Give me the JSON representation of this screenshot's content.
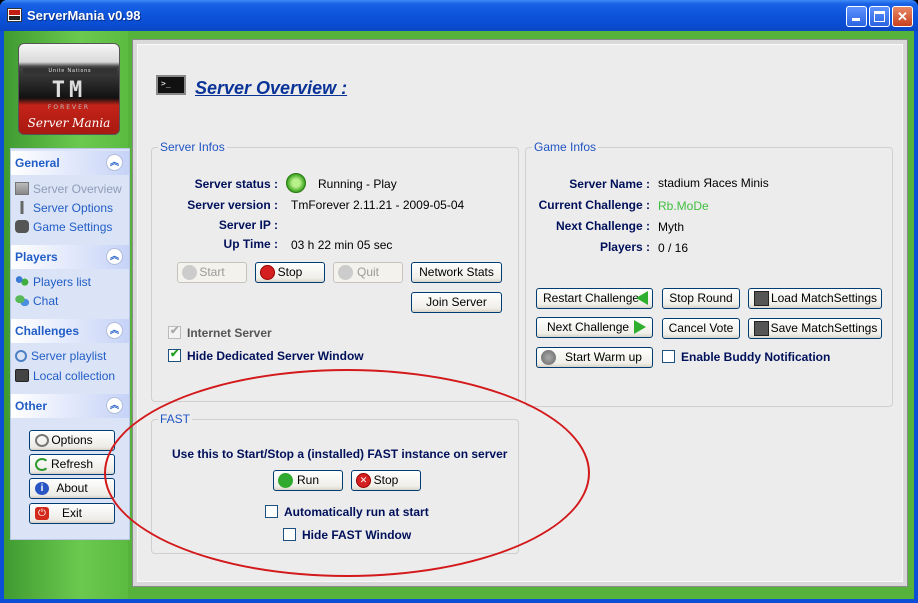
{
  "window": {
    "title": "ServerMania v0.98"
  },
  "logo": {
    "band_text": "Unite Nations",
    "tm_text": "TM",
    "sub_text": "FOREVER",
    "brand_text": "Server Mania"
  },
  "sidebar": {
    "general": {
      "title": "General",
      "items": [
        {
          "label": "Server Overview"
        },
        {
          "label": "Server Options"
        },
        {
          "label": "Game Settings"
        }
      ]
    },
    "players": {
      "title": "Players",
      "items": [
        {
          "label": "Players list"
        },
        {
          "label": "Chat"
        }
      ]
    },
    "challenges": {
      "title": "Challenges",
      "items": [
        {
          "label": "Server playlist"
        },
        {
          "label": "Local collection"
        }
      ]
    },
    "other": {
      "title": "Other",
      "buttons": [
        {
          "label": "Options"
        },
        {
          "label": "Refresh"
        },
        {
          "label": "About"
        },
        {
          "label": "Exit"
        }
      ]
    }
  },
  "page": {
    "title": "Server Overview :"
  },
  "server_infos": {
    "title": "Server Infos",
    "status_label": "Server status :",
    "status_value": "Running - Play",
    "version_label": "Server version :",
    "version_value": "TmForever 2.11.21 - 2009-05-04",
    "ip_label": "Server IP :",
    "ip_value": "",
    "uptime_label": "Up Time :",
    "uptime_value": "03 h 22 min 05 sec",
    "buttons": {
      "start": "Start",
      "stop": "Stop",
      "quit": "Quit",
      "network_stats": "Network Stats",
      "join_server": "Join Server"
    },
    "internet_server": "Internet Server",
    "hide_window": "Hide Dedicated Server Window"
  },
  "game_infos": {
    "title": "Game Infos",
    "name_label": "Server Name :",
    "name_value": "stadium Яaces Minis",
    "current_label": "Current Challenge :",
    "current_value": "Rb.MoDe",
    "next_label": "Next Challenge :",
    "next_value": "Myth",
    "players_label": "Players :",
    "players_value": "0 / 16",
    "buttons": {
      "restart": "Restart Challenge",
      "stop_round": "Stop Round",
      "load_match": "Load MatchSettings",
      "next": "Next Challenge",
      "cancel_vote": "Cancel Vote",
      "save_match": "Save MatchSettings",
      "warm_up": "Start Warm up"
    },
    "buddy": "Enable Buddy Notification"
  },
  "fast": {
    "title": "FAST",
    "description": "Use this to Start/Stop a (installed) FAST instance on server",
    "run": "Run",
    "stop": "Stop",
    "auto_run": "Automatically run at start",
    "hide_window": "Hide FAST Window"
  },
  "colors": {
    "accent": "#215dc6",
    "annotation": "#d3191b",
    "frame": "#55b33b"
  }
}
